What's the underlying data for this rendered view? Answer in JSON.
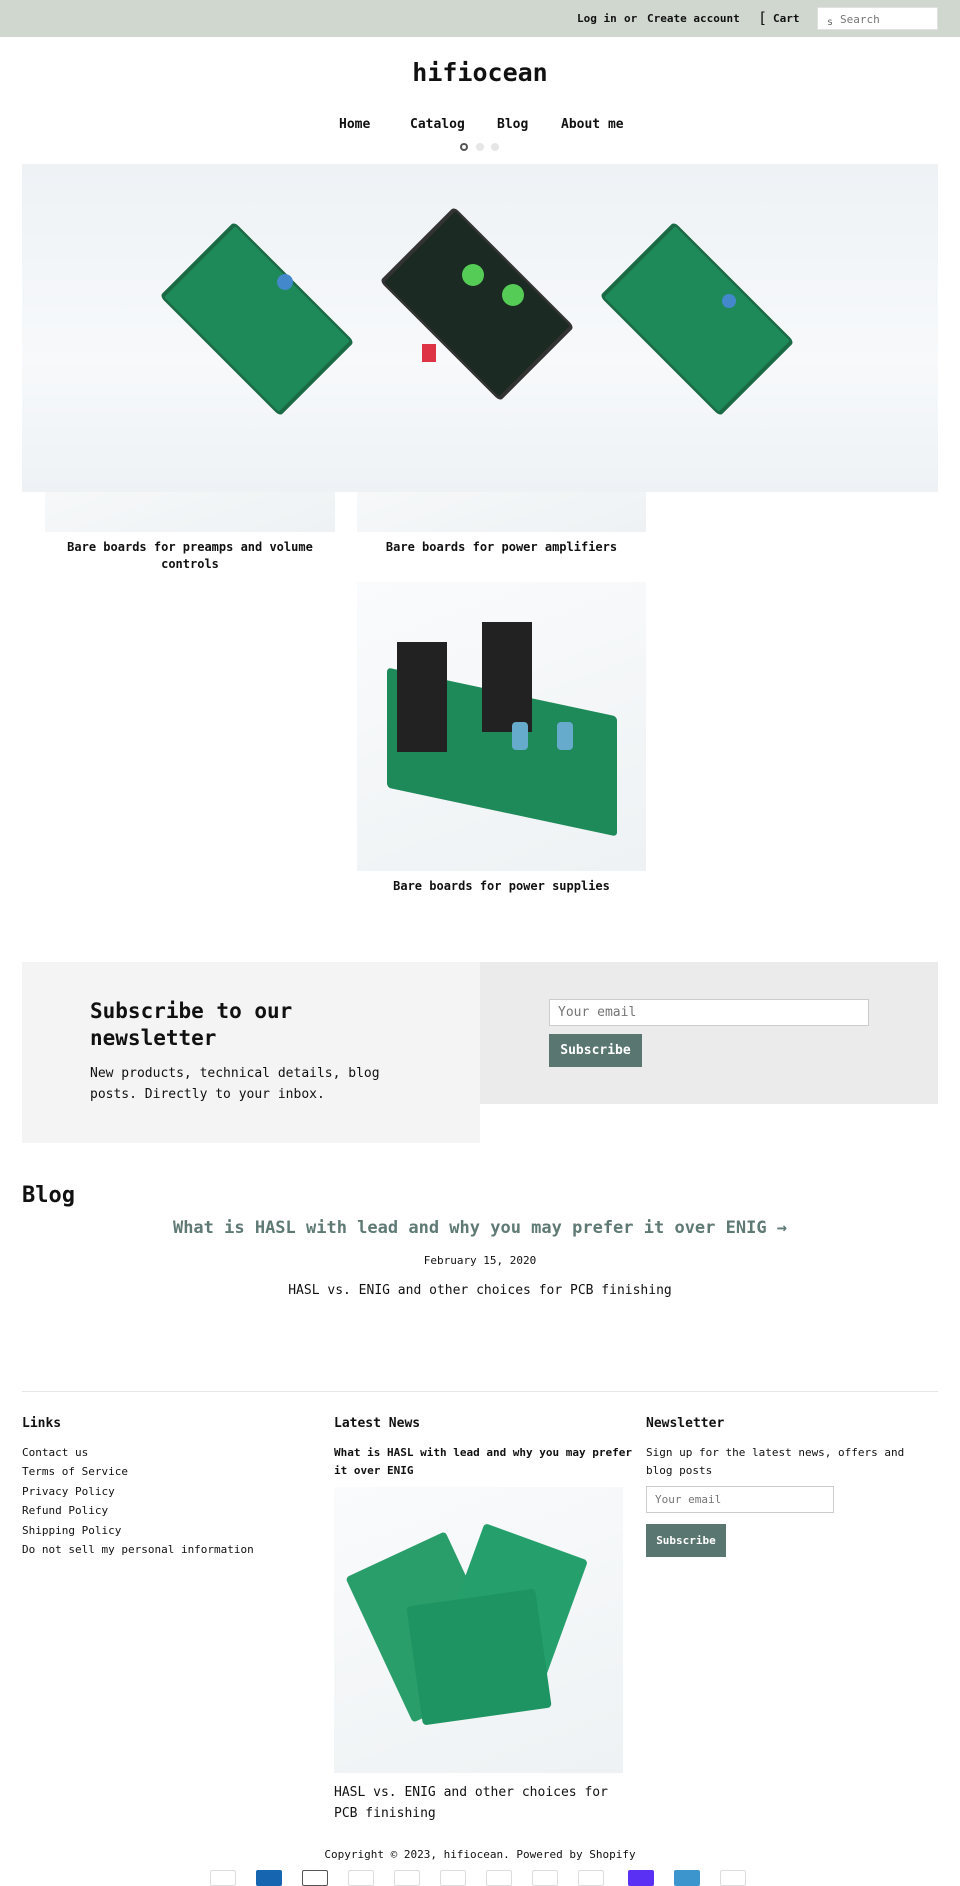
{
  "header": {
    "login": "Log in",
    "or": "or",
    "create_account": "Create account",
    "cart_icon": "cart-icon",
    "cart": "Cart",
    "search_placeholder": "Search",
    "search_icon_glyph": "s"
  },
  "site_title": "hifiocean",
  "nav": [
    "Home",
    "Catalog",
    "Blog",
    "About me"
  ],
  "slideshow": {
    "slides": 3,
    "active": 0
  },
  "collections": [
    {
      "label": "Bare boards for preamps and volume controls"
    },
    {
      "label": "Bare boards for power amplifiers"
    },
    {
      "label": "Bare boards for power supplies"
    }
  ],
  "newsletter": {
    "heading": "Subscribe to our newsletter",
    "text": "New products, technical details, blog posts. Directly to your inbox.",
    "email_placeholder": "Your email",
    "button": "Subscribe"
  },
  "blog": {
    "heading": "Blog",
    "post_title": "What is HASL with lead and why you may prefer it over ENIG →",
    "date": "February 15, 2020",
    "excerpt": "HASL vs. ENIG and other choices for PCB finishing"
  },
  "footer": {
    "links_heading": "Links",
    "links": [
      "Contact us",
      "Terms of Service",
      "Privacy Policy",
      "Refund Policy",
      "Shipping Policy",
      "Do not sell my personal information"
    ],
    "news_heading": "Latest News",
    "news_title": "What is HASL with lead and why you may prefer it over ENIG",
    "news_excerpt": "HASL vs. ENIG and other choices for PCB finishing",
    "newsletter_heading": "Newsletter",
    "newsletter_text": "Sign up for the latest news, offers and blog posts",
    "email_placeholder": "Your email",
    "button": "Subscribe",
    "copyright": "Copyright © 2023, hifiocean. Powered by Shopify"
  },
  "colors": {
    "topbar": "#cfd7cf",
    "accent": "#5a7670",
    "link": "#5f7a75"
  }
}
